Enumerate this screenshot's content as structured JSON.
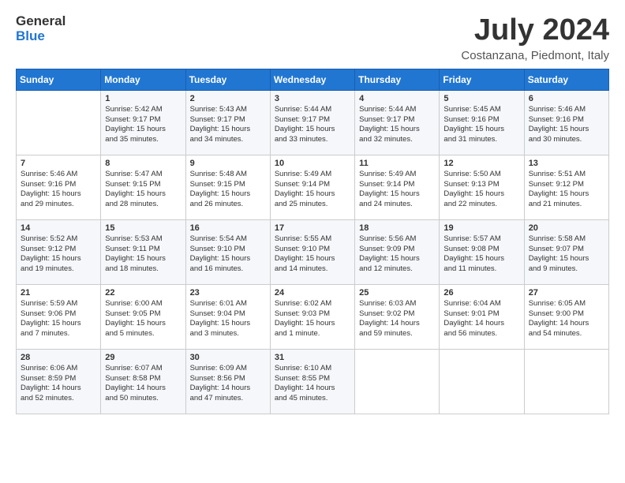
{
  "logo": {
    "line1": "General",
    "line2": "Blue"
  },
  "title": "July 2024",
  "location": "Costanzana, Piedmont, Italy",
  "days_of_week": [
    "Sunday",
    "Monday",
    "Tuesday",
    "Wednesday",
    "Thursday",
    "Friday",
    "Saturday"
  ],
  "weeks": [
    [
      {
        "day": "",
        "content": ""
      },
      {
        "day": "1",
        "content": "Sunrise: 5:42 AM\nSunset: 9:17 PM\nDaylight: 15 hours\nand 35 minutes."
      },
      {
        "day": "2",
        "content": "Sunrise: 5:43 AM\nSunset: 9:17 PM\nDaylight: 15 hours\nand 34 minutes."
      },
      {
        "day": "3",
        "content": "Sunrise: 5:44 AM\nSunset: 9:17 PM\nDaylight: 15 hours\nand 33 minutes."
      },
      {
        "day": "4",
        "content": "Sunrise: 5:44 AM\nSunset: 9:17 PM\nDaylight: 15 hours\nand 32 minutes."
      },
      {
        "day": "5",
        "content": "Sunrise: 5:45 AM\nSunset: 9:16 PM\nDaylight: 15 hours\nand 31 minutes."
      },
      {
        "day": "6",
        "content": "Sunrise: 5:46 AM\nSunset: 9:16 PM\nDaylight: 15 hours\nand 30 minutes."
      }
    ],
    [
      {
        "day": "7",
        "content": "Sunrise: 5:46 AM\nSunset: 9:16 PM\nDaylight: 15 hours\nand 29 minutes."
      },
      {
        "day": "8",
        "content": "Sunrise: 5:47 AM\nSunset: 9:15 PM\nDaylight: 15 hours\nand 28 minutes."
      },
      {
        "day": "9",
        "content": "Sunrise: 5:48 AM\nSunset: 9:15 PM\nDaylight: 15 hours\nand 26 minutes."
      },
      {
        "day": "10",
        "content": "Sunrise: 5:49 AM\nSunset: 9:14 PM\nDaylight: 15 hours\nand 25 minutes."
      },
      {
        "day": "11",
        "content": "Sunrise: 5:49 AM\nSunset: 9:14 PM\nDaylight: 15 hours\nand 24 minutes."
      },
      {
        "day": "12",
        "content": "Sunrise: 5:50 AM\nSunset: 9:13 PM\nDaylight: 15 hours\nand 22 minutes."
      },
      {
        "day": "13",
        "content": "Sunrise: 5:51 AM\nSunset: 9:12 PM\nDaylight: 15 hours\nand 21 minutes."
      }
    ],
    [
      {
        "day": "14",
        "content": "Sunrise: 5:52 AM\nSunset: 9:12 PM\nDaylight: 15 hours\nand 19 minutes."
      },
      {
        "day": "15",
        "content": "Sunrise: 5:53 AM\nSunset: 9:11 PM\nDaylight: 15 hours\nand 18 minutes."
      },
      {
        "day": "16",
        "content": "Sunrise: 5:54 AM\nSunset: 9:10 PM\nDaylight: 15 hours\nand 16 minutes."
      },
      {
        "day": "17",
        "content": "Sunrise: 5:55 AM\nSunset: 9:10 PM\nDaylight: 15 hours\nand 14 minutes."
      },
      {
        "day": "18",
        "content": "Sunrise: 5:56 AM\nSunset: 9:09 PM\nDaylight: 15 hours\nand 12 minutes."
      },
      {
        "day": "19",
        "content": "Sunrise: 5:57 AM\nSunset: 9:08 PM\nDaylight: 15 hours\nand 11 minutes."
      },
      {
        "day": "20",
        "content": "Sunrise: 5:58 AM\nSunset: 9:07 PM\nDaylight: 15 hours\nand 9 minutes."
      }
    ],
    [
      {
        "day": "21",
        "content": "Sunrise: 5:59 AM\nSunset: 9:06 PM\nDaylight: 15 hours\nand 7 minutes."
      },
      {
        "day": "22",
        "content": "Sunrise: 6:00 AM\nSunset: 9:05 PM\nDaylight: 15 hours\nand 5 minutes."
      },
      {
        "day": "23",
        "content": "Sunrise: 6:01 AM\nSunset: 9:04 PM\nDaylight: 15 hours\nand 3 minutes."
      },
      {
        "day": "24",
        "content": "Sunrise: 6:02 AM\nSunset: 9:03 PM\nDaylight: 15 hours\nand 1 minute."
      },
      {
        "day": "25",
        "content": "Sunrise: 6:03 AM\nSunset: 9:02 PM\nDaylight: 14 hours\nand 59 minutes."
      },
      {
        "day": "26",
        "content": "Sunrise: 6:04 AM\nSunset: 9:01 PM\nDaylight: 14 hours\nand 56 minutes."
      },
      {
        "day": "27",
        "content": "Sunrise: 6:05 AM\nSunset: 9:00 PM\nDaylight: 14 hours\nand 54 minutes."
      }
    ],
    [
      {
        "day": "28",
        "content": "Sunrise: 6:06 AM\nSunset: 8:59 PM\nDaylight: 14 hours\nand 52 minutes."
      },
      {
        "day": "29",
        "content": "Sunrise: 6:07 AM\nSunset: 8:58 PM\nDaylight: 14 hours\nand 50 minutes."
      },
      {
        "day": "30",
        "content": "Sunrise: 6:09 AM\nSunset: 8:56 PM\nDaylight: 14 hours\nand 47 minutes."
      },
      {
        "day": "31",
        "content": "Sunrise: 6:10 AM\nSunset: 8:55 PM\nDaylight: 14 hours\nand 45 minutes."
      },
      {
        "day": "",
        "content": ""
      },
      {
        "day": "",
        "content": ""
      },
      {
        "day": "",
        "content": ""
      }
    ]
  ]
}
